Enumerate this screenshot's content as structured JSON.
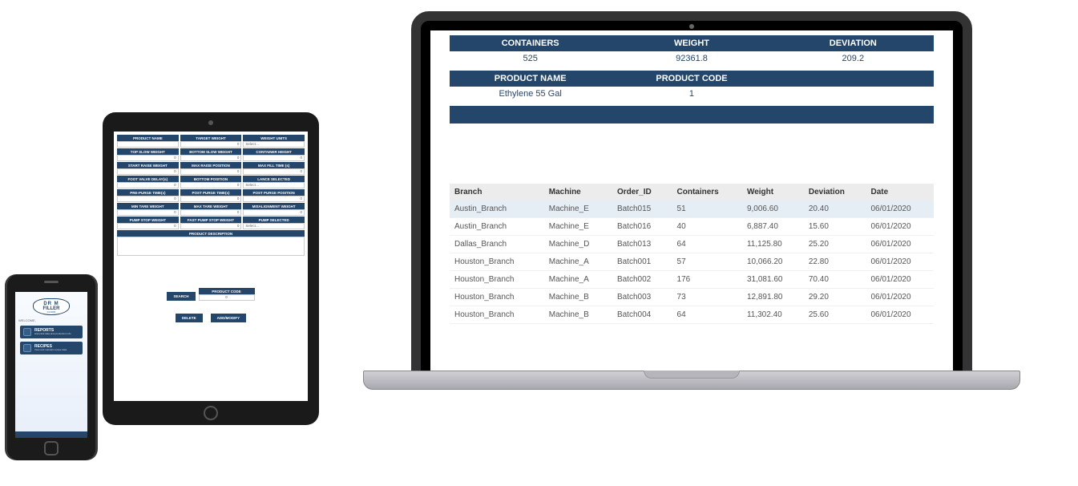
{
  "colors": {
    "navy": "#24466b"
  },
  "laptop": {
    "summary": {
      "headers": [
        "CONTAINERS",
        "WEIGHT",
        "DEVIATION"
      ],
      "values": [
        "525",
        "92361.8",
        "209.2"
      ]
    },
    "product": {
      "headers": [
        "PRODUCT NAME",
        "PRODUCT CODE"
      ],
      "values": [
        "Ethylene 55 Gal",
        "1"
      ]
    },
    "table": {
      "columns": [
        "Branch",
        "Machine",
        "Order_ID",
        "Containers",
        "Weight",
        "Deviation",
        "Date"
      ],
      "rows": [
        [
          "Austin_Branch",
          "Machine_E",
          "Batch015",
          "51",
          "9,006.60",
          "20.40",
          "06/01/2020"
        ],
        [
          "Austin_Branch",
          "Machine_E",
          "Batch016",
          "40",
          "6,887.40",
          "15.60",
          "06/01/2020"
        ],
        [
          "Dallas_Branch",
          "Machine_D",
          "Batch013",
          "64",
          "11,125.80",
          "25.20",
          "06/01/2020"
        ],
        [
          "Houston_Branch",
          "Machine_A",
          "Batch001",
          "57",
          "10,066.20",
          "22.80",
          "06/01/2020"
        ],
        [
          "Houston_Branch",
          "Machine_A",
          "Batch002",
          "176",
          "31,081.60",
          "70.40",
          "06/01/2020"
        ],
        [
          "Houston_Branch",
          "Machine_B",
          "Batch003",
          "73",
          "12,891.80",
          "29.20",
          "06/01/2020"
        ],
        [
          "Houston_Branch",
          "Machine_B",
          "Batch004",
          "64",
          "11,302.40",
          "25.60",
          "06/01/2020"
        ]
      ]
    }
  },
  "tablet": {
    "rows": [
      {
        "cells": [
          {
            "label": "PRODUCT NAME",
            "value": "",
            "type": "text"
          },
          {
            "label": "TARGET WEIGHT",
            "value": "0",
            "type": "num"
          },
          {
            "label": "WEIGHT UNITS",
            "value": "Select…",
            "type": "select"
          }
        ]
      },
      {
        "cells": [
          {
            "label": "TOP SLOW WEIGHT",
            "value": "0",
            "type": "num"
          },
          {
            "label": "BOTTOM SLOW WEIGHT",
            "value": "0",
            "type": "num"
          },
          {
            "label": "CONTAINER HEIGHT",
            "value": "0",
            "type": "num"
          }
        ]
      },
      {
        "cells": [
          {
            "label": "START RAISE WEIGHT",
            "value": "0",
            "type": "num"
          },
          {
            "label": "MAX RAISE POSITION",
            "value": "0",
            "type": "num"
          },
          {
            "label": "MAX FILL TIME (s)",
            "value": "0",
            "type": "num"
          }
        ]
      },
      {
        "cells": [
          {
            "label": "FOOT VALVE DELAY(s)",
            "value": "0",
            "type": "num"
          },
          {
            "label": "BOTTOM POSITION",
            "value": "0",
            "type": "num"
          },
          {
            "label": "LANCE SELECTED",
            "value": "Select…",
            "type": "select"
          }
        ]
      },
      {
        "cells": [
          {
            "label": "PRE-PURGE TIME(s)",
            "value": "0",
            "type": "num"
          },
          {
            "label": "POST PURGE TIME(s)",
            "value": "0",
            "type": "num"
          },
          {
            "label": "POST PURGE POSITION",
            "value": "0",
            "type": "num"
          }
        ]
      },
      {
        "cells": [
          {
            "label": "MIN TARE WEIGHT",
            "value": "0",
            "type": "num"
          },
          {
            "label": "MAX TARE WEIGHT",
            "value": "0",
            "type": "num"
          },
          {
            "label": "MISALIGNMENT WEIGHT",
            "value": "0",
            "type": "num"
          }
        ]
      },
      {
        "cells": [
          {
            "label": "PUMP STOP WEIGHT",
            "value": "0",
            "type": "num"
          },
          {
            "label": "FAST PUMP STOP WEIGHT",
            "value": "0",
            "type": "num"
          },
          {
            "label": "PUMP SELECTED",
            "value": "Select…",
            "type": "select"
          }
        ]
      }
    ],
    "desc_label": "PRODUCT DESCRIPTION",
    "search_label": "SEARCH",
    "product_code_label": "PRODUCT CODE",
    "product_code_value": "0",
    "delete_label": "DELETE",
    "addmod_label": "ADD/MODIFY"
  },
  "phone": {
    "logo_top": "DR   M",
    "logo_mid": "FILLER",
    "logo_sub": "CLOUD",
    "welcome": "WELCOME,",
    "menu": [
      {
        "title": "REPORTS",
        "sub": "Historical data and production info"
      },
      {
        "title": "RECIPES",
        "sub": "View and maintain recipe data"
      }
    ]
  }
}
